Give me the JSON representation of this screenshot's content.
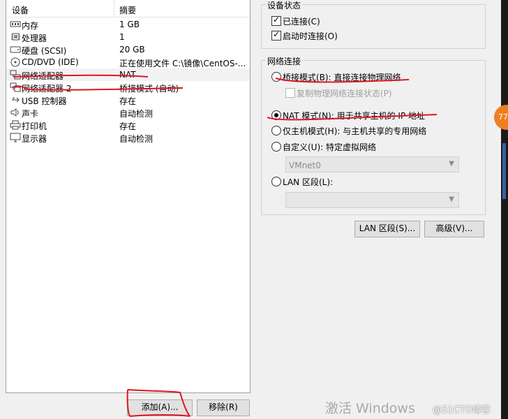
{
  "device_list": {
    "columns": [
      "设备",
      "摘要"
    ],
    "rows": [
      {
        "icon": "memory-icon",
        "name": "内存",
        "summary": "1 GB"
      },
      {
        "icon": "processor-icon",
        "name": "处理器",
        "summary": "1"
      },
      {
        "icon": "hard-disk-icon",
        "name": "硬盘 (SCSI)",
        "summary": "20 GB"
      },
      {
        "icon": "cd-dvd-icon",
        "name": "CD/DVD (IDE)",
        "summary": "正在使用文件 C:\\镜像\\CentOS-..."
      },
      {
        "icon": "network-adapter-icon",
        "name": "网络适配器",
        "summary": "NAT"
      },
      {
        "icon": "network-adapter-icon",
        "name": "网络适配器 2",
        "summary": "桥接模式 (自动)"
      },
      {
        "icon": "usb-icon",
        "name": "USB 控制器",
        "summary": "存在"
      },
      {
        "icon": "sound-card-icon",
        "name": "声卡",
        "summary": "自动检测"
      },
      {
        "icon": "printer-icon",
        "name": "打印机",
        "summary": "存在"
      },
      {
        "icon": "display-icon",
        "name": "显示器",
        "summary": "自动检测"
      }
    ],
    "selected_index": 4
  },
  "buttons": {
    "add": "添加(A)...",
    "remove": "移除(R)"
  },
  "device_status": {
    "title": "设备状态",
    "connected": {
      "label": "已连接(C)",
      "checked": true
    },
    "connect_at_power_on": {
      "label": "启动时连接(O)",
      "checked": true
    }
  },
  "network_connection": {
    "title": "网络连接",
    "bridged": {
      "label": "桥接模式(B): 直接连接物理网络",
      "selected": false
    },
    "replicate": {
      "label": "复制物理网络连接状态(P)",
      "checked": false
    },
    "nat": {
      "label": "NAT 模式(N): 用于共享主机的 IP 地址",
      "selected": true
    },
    "host_only": {
      "label": "仅主机模式(H): 与主机共享的专用网络",
      "selected": false
    },
    "custom": {
      "label": "自定义(U): 特定虚拟网络",
      "selected": false
    },
    "custom_value": "VMnet0",
    "lan_segment": {
      "label": "LAN 区段(L):",
      "selected": false
    },
    "lan_segment_value": ""
  },
  "bottom_buttons": {
    "lan_segments": "LAN 区段(S)...",
    "advanced": "高级(V)..."
  },
  "overlay": {
    "watermark": "激活 Windows",
    "credit": "@51CTO博客",
    "badge": "77"
  },
  "colors": {
    "annotation_red": "#e0141e",
    "badge_orange": "#ef7e23"
  }
}
